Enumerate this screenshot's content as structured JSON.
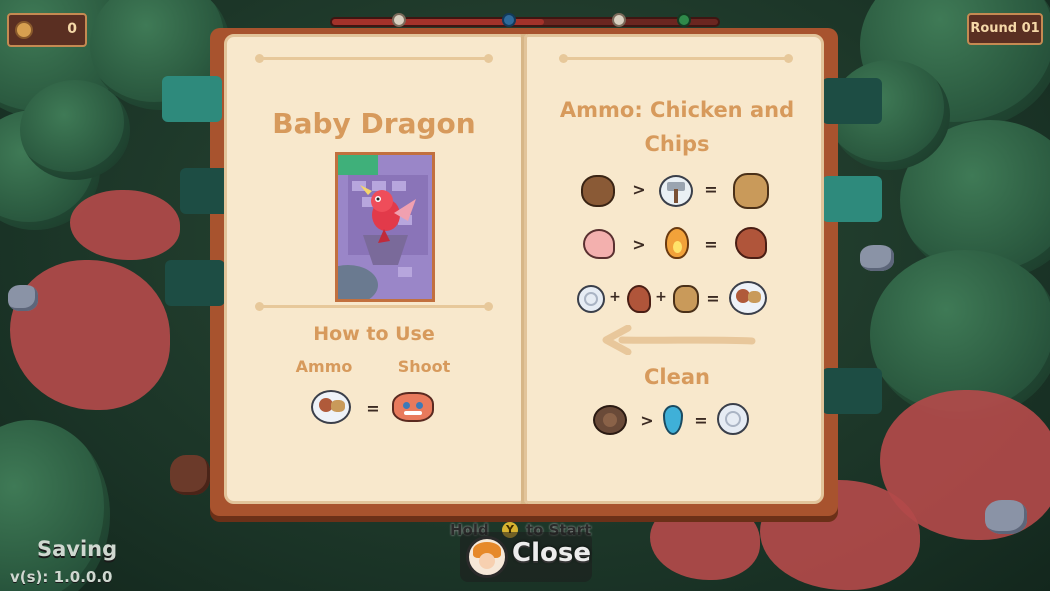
{
  "hud": {
    "coins": "0",
    "round": "Round 01",
    "wave_progress": 0.55
  },
  "book": {
    "left_page": {
      "title": "Baby Dragon",
      "how_to_use": "How to Use",
      "ammo_label": "Ammo",
      "shoot_label": "Shoot",
      "equals": "="
    },
    "right_page": {
      "title": "Ammo: Chicken and Chips",
      "recipes": [
        {
          "input": "potato-icon",
          "op": ">",
          "tool": "hammer-icon",
          "eq": "=",
          "output": "chips-icon"
        },
        {
          "input": "raw-chicken-icon",
          "op": ">",
          "tool": "fire-icon",
          "eq": "=",
          "output": "cooked-chicken-icon"
        },
        {
          "plate": "plate-icon",
          "plus1": "+",
          "chicken": "cooked-chicken-icon",
          "plus2": "+",
          "chips": "chips-icon",
          "eq": "=",
          "output": "chicken-and-chips-plate-icon"
        }
      ],
      "clean_title": "Clean",
      "clean_recipe": {
        "input": "dirty-plate-icon",
        "op": ">",
        "tool": "water-drop-icon",
        "eq": "=",
        "output": "clean-plate-icon"
      }
    }
  },
  "footer": {
    "hold_text": "Hold",
    "button_glyph": "Y",
    "to_start": "to Start",
    "close_label": "Close",
    "saving": "Saving",
    "version": "v(s): 1.0.0.0"
  },
  "colors": {
    "page": "#f8e8cc",
    "heading": "#d79a5c",
    "book_cover": "#a8532e",
    "tab_teal": "#2e8a7c"
  }
}
